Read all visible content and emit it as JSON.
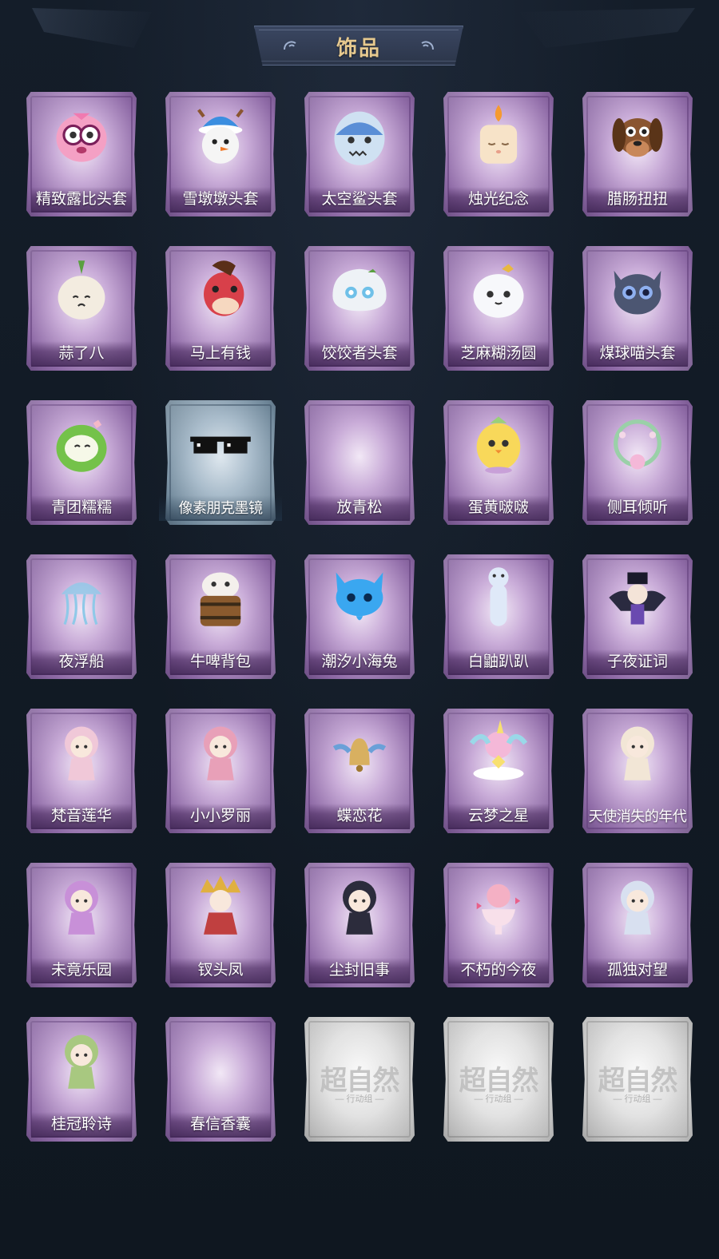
{
  "header": {
    "title": "饰品"
  },
  "items": [
    {
      "name": "精致露比头套",
      "style": "purple",
      "icon": "pink-face",
      "color": "#f4a0c4"
    },
    {
      "name": "雪墩墩头套",
      "style": "purple",
      "icon": "snowman",
      "color": "#f5f5f5"
    },
    {
      "name": "太空鲨头套",
      "style": "purple",
      "icon": "shark",
      "color": "#cfe1f2"
    },
    {
      "name": "烛光纪念",
      "style": "purple",
      "icon": "candle",
      "color": "#f7e3c8"
    },
    {
      "name": "腊肠扭扭",
      "style": "purple",
      "icon": "dog",
      "color": "#8a5530"
    },
    {
      "name": "蒜了八",
      "style": "purple",
      "icon": "garlic",
      "color": "#f3ece0"
    },
    {
      "name": "马上有钱",
      "style": "purple",
      "icon": "horse",
      "color": "#d8404a"
    },
    {
      "name": "饺饺者头套",
      "style": "purple",
      "icon": "dumpling",
      "color": "#eef2f6"
    },
    {
      "name": "芝麻糊汤圆",
      "style": "purple",
      "icon": "ball",
      "color": "#f7f8fb"
    },
    {
      "name": "煤球喵头套",
      "style": "purple",
      "icon": "cat",
      "color": "#4c5672"
    },
    {
      "name": "青团糯糯",
      "style": "purple",
      "icon": "green-ball",
      "color": "#74c24a"
    },
    {
      "name": "像素朋克墨镜",
      "style": "blue",
      "icon": "sunglasses",
      "color": "#111111",
      "long": true
    },
    {
      "name": "放青松",
      "style": "purple",
      "icon": "empty",
      "color": ""
    },
    {
      "name": "蛋黄啵啵",
      "style": "purple",
      "icon": "chick",
      "color": "#f8d85a"
    },
    {
      "name": "侧耳倾听",
      "style": "purple",
      "icon": "wreath",
      "color": "#9ad0a8"
    },
    {
      "name": "夜浮船",
      "style": "purple",
      "icon": "jellyfish",
      "color": "#8fc9e8"
    },
    {
      "name": "牛啤背包",
      "style": "purple",
      "icon": "barrel",
      "color": "#8a5a2e"
    },
    {
      "name": "潮汐小海兔",
      "style": "purple",
      "icon": "blue-fox",
      "color": "#3aa7f0"
    },
    {
      "name": "白鼬趴趴",
      "style": "purple",
      "icon": "ferret",
      "color": "#dfe9f8"
    },
    {
      "name": "子夜证词",
      "style": "purple",
      "icon": "dark-doll",
      "color": "#2a2a40"
    },
    {
      "name": "梵音莲华",
      "style": "purple",
      "icon": "doll",
      "color": "#f0c8d8"
    },
    {
      "name": "小小罗丽",
      "style": "purple",
      "icon": "doll-pink",
      "color": "#e8a0b8"
    },
    {
      "name": "蝶恋花",
      "style": "purple",
      "icon": "bell",
      "color": "#d8b060"
    },
    {
      "name": "云梦之星",
      "style": "purple",
      "icon": "unicorn",
      "color": "#f4b8d8"
    },
    {
      "name": "天使消失的年代",
      "style": "purple",
      "icon": "angel",
      "color": "#f2e6d6",
      "long": true
    },
    {
      "name": "未竟乐园",
      "style": "purple",
      "icon": "doll-purple",
      "color": "#c890d8"
    },
    {
      "name": "钗头凤",
      "style": "purple",
      "icon": "crown-doll",
      "color": "#e0b040"
    },
    {
      "name": "尘封旧事",
      "style": "purple",
      "icon": "boy-doll",
      "color": "#2c2c3c"
    },
    {
      "name": "不朽的今夜",
      "style": "purple",
      "icon": "cup",
      "color": "#f4b0c4"
    },
    {
      "name": "孤独对望",
      "style": "purple",
      "icon": "white-doll",
      "color": "#d8e0f0"
    },
    {
      "name": "桂冠聆诗",
      "style": "purple",
      "icon": "green-doll",
      "color": "#a8c880"
    },
    {
      "name": "春信香囊",
      "style": "purple",
      "icon": "empty",
      "color": ""
    },
    {
      "name": "",
      "style": "locked",
      "icon": "watermark",
      "color": "",
      "watermark": "超自然",
      "watermark_sub": "— 行动组 —"
    },
    {
      "name": "",
      "style": "locked",
      "icon": "watermark",
      "color": "",
      "watermark": "超自然",
      "watermark_sub": "— 行动组 —"
    },
    {
      "name": "",
      "style": "locked",
      "icon": "watermark",
      "color": "",
      "watermark": "超自然",
      "watermark_sub": "— 行动组 —"
    }
  ]
}
